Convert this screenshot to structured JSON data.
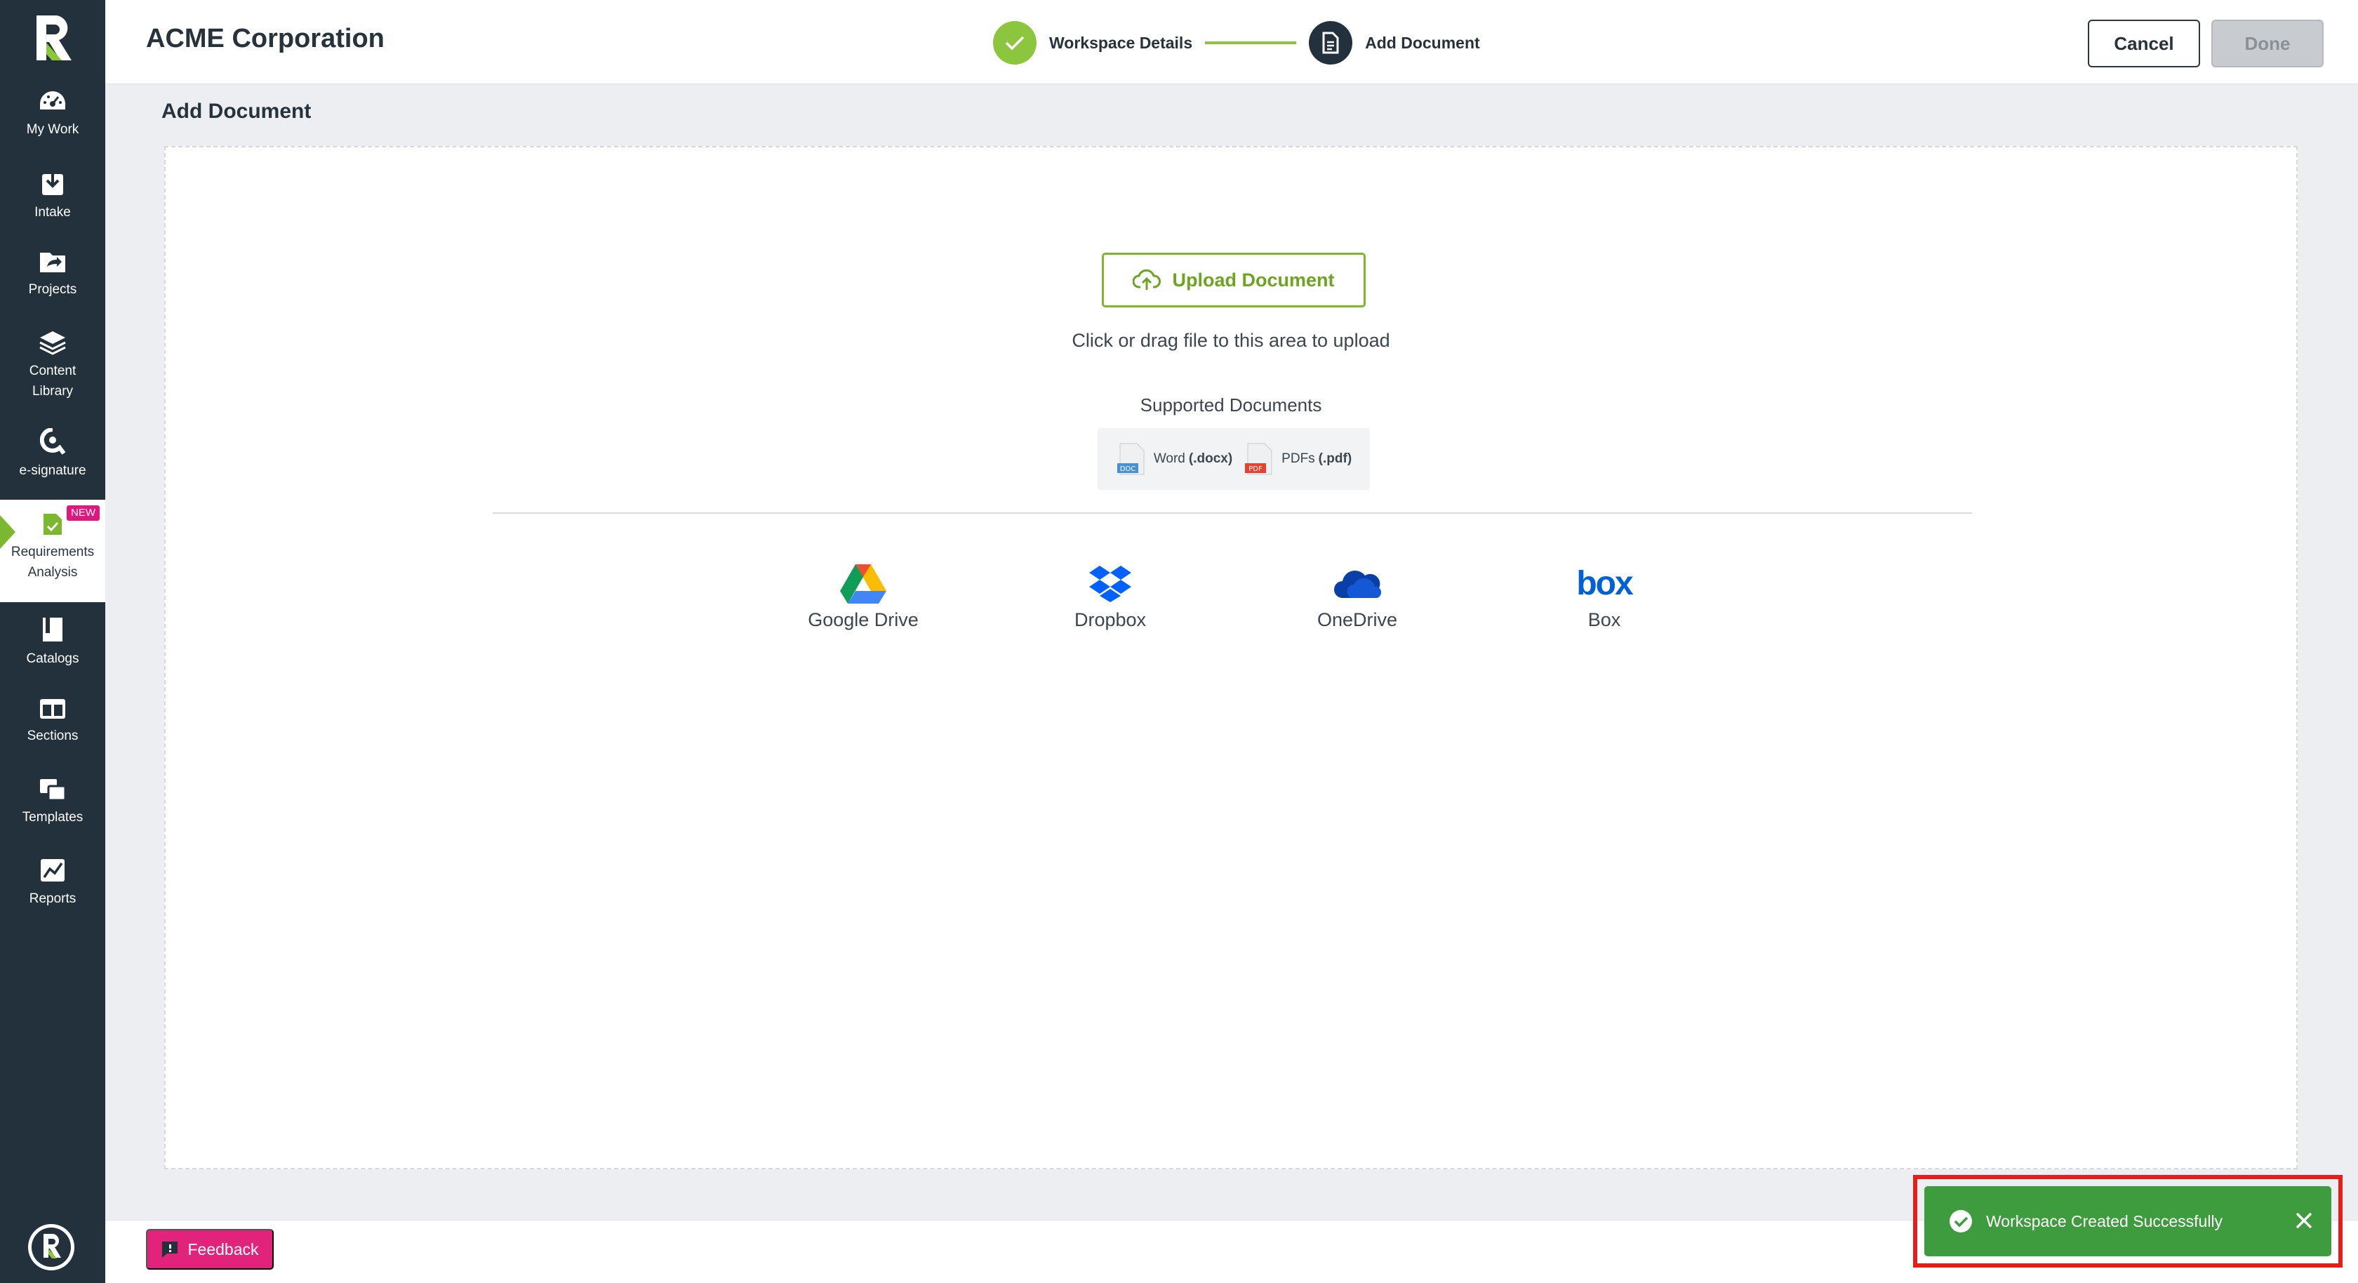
{
  "sidebar": {
    "items": [
      {
        "label": "My Work",
        "icon": "speedometer-icon"
      },
      {
        "label": "Intake",
        "icon": "download-icon"
      },
      {
        "label": "Projects",
        "icon": "folder-share-icon"
      },
      {
        "label": "Content Library",
        "icon": "layers-icon"
      },
      {
        "label": "e-signature",
        "icon": "signature-icon"
      },
      {
        "label": "Requirements Analysis",
        "icon": "document-check-icon",
        "badge": "NEW",
        "active": true
      },
      {
        "label": "Catalogs",
        "icon": "book-icon"
      },
      {
        "label": "Sections",
        "icon": "sections-icon"
      },
      {
        "label": "Templates",
        "icon": "templates-icon"
      },
      {
        "label": "Reports",
        "icon": "chart-icon"
      }
    ]
  },
  "header": {
    "company": "ACME Corporation",
    "steps": [
      {
        "label": "Workspace Details",
        "state": "done"
      },
      {
        "label": "Add Document",
        "state": "current"
      }
    ],
    "cancel_label": "Cancel",
    "done_label": "Done"
  },
  "main": {
    "title": "Add Document",
    "upload_label": "Upload Document",
    "drag_hint": "Click or drag file to this area to upload",
    "supported_title": "Supported Documents",
    "doc_types": [
      {
        "name": "Word",
        "ext": "(.docx)",
        "badge": "DOC",
        "color": "#4a90d9"
      },
      {
        "name": "PDFs",
        "ext": "(.pdf)",
        "badge": "PDF",
        "color": "#e8412f"
      }
    ],
    "sources": [
      {
        "label": "Google Drive",
        "icon": "google-drive-icon"
      },
      {
        "label": "Dropbox",
        "icon": "dropbox-icon"
      },
      {
        "label": "OneDrive",
        "icon": "onedrive-icon"
      },
      {
        "label": "Box",
        "icon": "box-icon",
        "logo_text": "box"
      }
    ]
  },
  "footer": {
    "feedback_label": "Feedback"
  },
  "toast": {
    "message": "Workspace Created Successfully"
  },
  "colors": {
    "sidebar_bg": "#22313c",
    "accent_green": "#8cc63f",
    "toast_green": "#3e9b3e",
    "feedback_pink": "#e2237c",
    "highlight_red": "#e41d1d"
  }
}
